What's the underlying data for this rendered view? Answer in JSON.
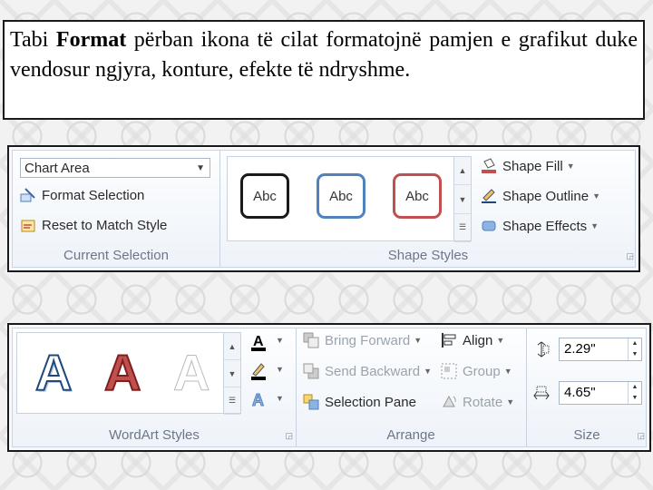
{
  "caption": {
    "prefix": "Tabi ",
    "bold": "Format",
    "rest": " përban ikona të cilat formatojnë pamjen e grafikut duke vendosur ngjyra, konture, efekte të ndryshme."
  },
  "ribbon_top": {
    "current_selection": {
      "combo_value": "Chart Area",
      "format_selection": "Format Selection",
      "reset_style": "Reset to Match Style",
      "label": "Current Selection"
    },
    "shape_styles": {
      "swatches": [
        "Abc",
        "Abc",
        "Abc"
      ],
      "swatch_colors": [
        "#1a1a1a",
        "#4f81bd",
        "#c0504d"
      ],
      "shape_fill": "Shape Fill",
      "shape_outline": "Shape Outline",
      "shape_effects": "Shape Effects",
      "label": "Shape Styles"
    }
  },
  "ribbon_bottom": {
    "wordart": {
      "letters": [
        "A",
        "A",
        "A"
      ],
      "label": "WordArt Styles"
    },
    "arrange": {
      "bring_forward": "Bring Forward",
      "send_backward": "Send Backward",
      "selection_pane": "Selection Pane",
      "align": "Align",
      "group": "Group",
      "rotate": "Rotate",
      "label": "Arrange"
    },
    "size": {
      "height": "2.29\"",
      "width": "4.65\"",
      "label": "Size"
    }
  }
}
